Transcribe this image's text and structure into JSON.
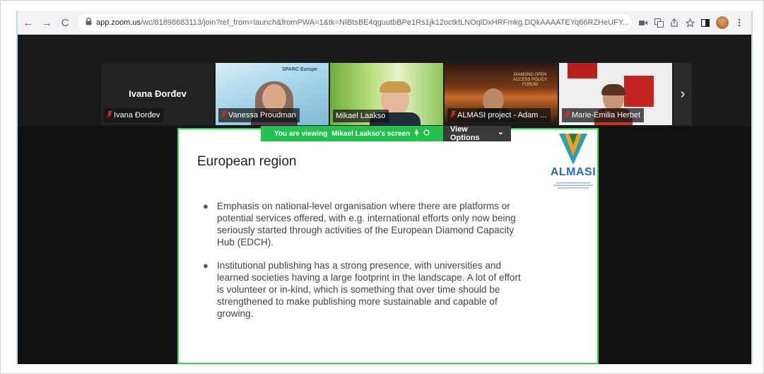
{
  "browser": {
    "url_domain": "app.zoom.us",
    "url_rest": "/wc/81898683113/join?ref_from=launch&fromPWA=1&tk=NIBtsBE4qguutbBPe1Rs1jk12octktLNOqlDxHRFmkg.DQkAAAATEYq66RZHeUFY...",
    "back_glyph": "←",
    "forward_glyph": "→",
    "reload_glyph": "C",
    "lock_glyph": "🔒",
    "icons": [
      "camera-icon",
      "translate-icon",
      "share-icon",
      "star-icon",
      "sidebar-icon",
      "profile-avatar",
      "menu-icon"
    ]
  },
  "participants": [
    {
      "name": "Ivana Đorđev",
      "label": "Ivana Đorđev",
      "type": "name-only"
    },
    {
      "label": "Vanessa Proudman",
      "type": "video",
      "badge": "SPARC Europe"
    },
    {
      "label": "Mikael Laakso",
      "type": "video"
    },
    {
      "label": "ALMASI project - Adam ...",
      "type": "video",
      "screen_text": "DIAMOND OPEN ACCESS POLICY FORUM"
    },
    {
      "label": "Marie-Emilia Herbet",
      "type": "video"
    }
  ],
  "next_glyph": "›",
  "share_banner": {
    "viewing_text": "You are viewing",
    "viewing_name": "Mikael Laakso's screen",
    "view_options": "View Options",
    "chevron": "⌄"
  },
  "slide": {
    "title": "European region",
    "logo_text": "ALMASI",
    "bullets": [
      "Emphasis on national-level organisation where there are platforms or potential services offered, with e.g. international efforts only now being seriously started through activities of the European Diamond Capacity Hub (EDCH).",
      "Institutional publishing has a strong presence, with universities and learned societies having a large footprint in the landscape. A lot of effort is volunteer or in-kind, which is something that over time should be strengthened to make publishing more sustainable and capable of growing."
    ]
  },
  "colors": {
    "accent_green": "#23c24e",
    "mic_off_red": "#e02828",
    "logo_blue": "#2a6bb3"
  }
}
